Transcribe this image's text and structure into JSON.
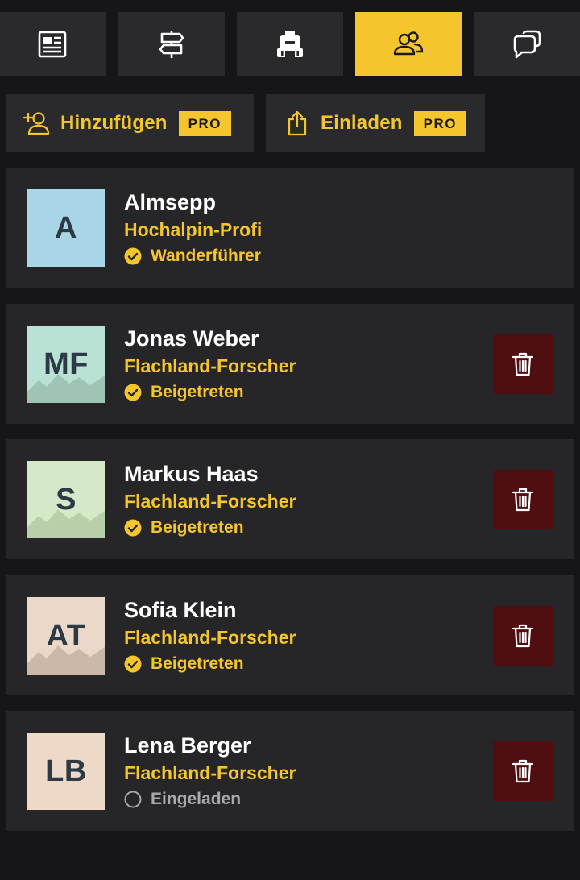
{
  "tabs": [
    {
      "name": "news-tab",
      "icon": "newspaper-icon",
      "active": false
    },
    {
      "name": "routes-tab",
      "icon": "signpost-icon",
      "active": false
    },
    {
      "name": "gear-tab",
      "icon": "backpack-icon",
      "active": false
    },
    {
      "name": "members-tab",
      "icon": "users-icon",
      "active": true
    },
    {
      "name": "chat-tab",
      "icon": "chat-bubbles-icon",
      "active": false
    }
  ],
  "actions": {
    "add": {
      "label": "Hinzufügen",
      "badge": "PRO",
      "icon": "add-user-icon"
    },
    "invite": {
      "label": "Einladen",
      "badge": "PRO",
      "icon": "share-icon"
    }
  },
  "members": [
    {
      "initials": "A",
      "name": "Almsepp",
      "role": "Hochalpin-Profi",
      "status": "Wanderführer",
      "status_type": "confirmed",
      "avatar_color": "#a9d6e6",
      "mountains": false,
      "mountain_color": "",
      "deletable": false
    },
    {
      "initials": "MF",
      "name": "Jonas Weber",
      "role": "Flachland-Forscher",
      "status": "Beigetreten",
      "status_type": "confirmed",
      "avatar_color": "#b9e2d4",
      "mountains": true,
      "mountain_color": "#9fc4b4",
      "deletable": true
    },
    {
      "initials": "S",
      "name": "Markus Haas",
      "role": "Flachland-Forscher",
      "status": "Beigetreten",
      "status_type": "confirmed",
      "avatar_color": "#d5e8c8",
      "mountains": true,
      "mountain_color": "#b9cfa9",
      "deletable": true
    },
    {
      "initials": "AT",
      "name": "Sofia Klein",
      "role": "Flachland-Forscher",
      "status": "Beigetreten",
      "status_type": "confirmed",
      "avatar_color": "#ecd8c8",
      "mountains": true,
      "mountain_color": "#cbb8a9",
      "deletable": true
    },
    {
      "initials": "LB",
      "name": "Lena Berger",
      "role": "Flachland-Forscher",
      "status": "Eingeladen",
      "status_type": "pending",
      "avatar_color": "#eed9c9",
      "mountains": false,
      "mountain_color": "",
      "deletable": true
    }
  ],
  "colors": {
    "accent": "#f5c52e",
    "card": "#262629",
    "background": "#161618",
    "delete": "#4e0e12",
    "pending": "#a9a9ad"
  }
}
